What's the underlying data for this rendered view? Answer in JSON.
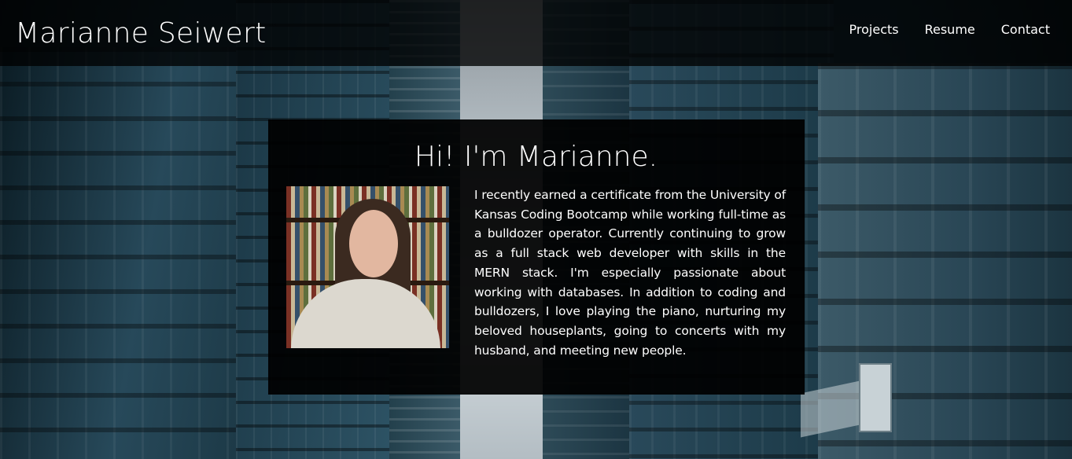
{
  "header": {
    "brand": "Marianne Seiwert",
    "nav": [
      {
        "label": "Projects"
      },
      {
        "label": "Resume"
      },
      {
        "label": "Contact"
      }
    ]
  },
  "about": {
    "heading": "Hi! I'm Marianne.",
    "photo_icon": "profile-photo",
    "bio": "I recently earned a certificate from the University of Kansas Coding Bootcamp while working full-time as a bulldozer operator. Currently continuing to grow as a full stack web developer with skills in the MERN stack. I'm especially passionate about working with databases. In addition to coding and bulldozers, I love playing the piano, nurturing my beloved houseplants, going to concerts with my husband, and meeting new people."
  },
  "colors": {
    "header_bg": "#000000",
    "card_bg": "#000000",
    "text": "#ffffff"
  }
}
